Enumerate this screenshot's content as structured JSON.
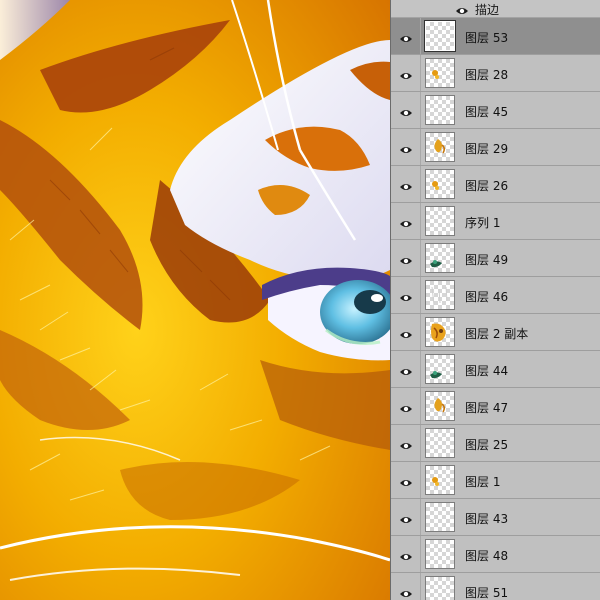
{
  "layers_panel": {
    "effect": {
      "label": "描边",
      "visible": true
    },
    "layers": [
      {
        "name": "图层 53",
        "selected": true,
        "thumb": "blank"
      },
      {
        "name": "图层 28",
        "selected": false,
        "thumb": "small-orange"
      },
      {
        "name": "图层 45",
        "selected": false,
        "thumb": "blank"
      },
      {
        "name": "图层 29",
        "selected": false,
        "thumb": "orange-flame"
      },
      {
        "name": "图层 26",
        "selected": false,
        "thumb": "small-orange"
      },
      {
        "name": "序列 1",
        "selected": false,
        "thumb": "blank"
      },
      {
        "name": "图层 49",
        "selected": false,
        "thumb": "green-dark"
      },
      {
        "name": "图层 46",
        "selected": false,
        "thumb": "faint-lines"
      },
      {
        "name": "图层 2 副本",
        "selected": false,
        "thumb": "orange-pattern"
      },
      {
        "name": "图层 44",
        "selected": false,
        "thumb": "green-dark"
      },
      {
        "name": "图层 47",
        "selected": false,
        "thumb": "orange-flame"
      },
      {
        "name": "图层 25",
        "selected": false,
        "thumb": "blank"
      },
      {
        "name": "图层 1",
        "selected": false,
        "thumb": "small-orange"
      },
      {
        "name": "图层 43",
        "selected": false,
        "thumb": "blank"
      },
      {
        "name": "图层 48",
        "selected": false,
        "thumb": "blank"
      },
      {
        "name": "图层 51",
        "selected": false,
        "thumb": "blank"
      }
    ]
  },
  "canvas": {
    "subject": "tiger-fur-eye-artwork",
    "colors": {
      "fur_yellow": "#f5b800",
      "fur_orange": "#e07a00",
      "fur_brown": "#a8430a",
      "white_fur": "#f4f2fb",
      "eye_iris": "#6ec8e6",
      "eye_pupil": "#173a4a",
      "eye_shadow": "#4c3d8a"
    }
  },
  "ui_colors": {
    "panel_bg": "#c0c0c0",
    "selected_row": "#8f8f8f",
    "divider": "#9e9e9e"
  }
}
